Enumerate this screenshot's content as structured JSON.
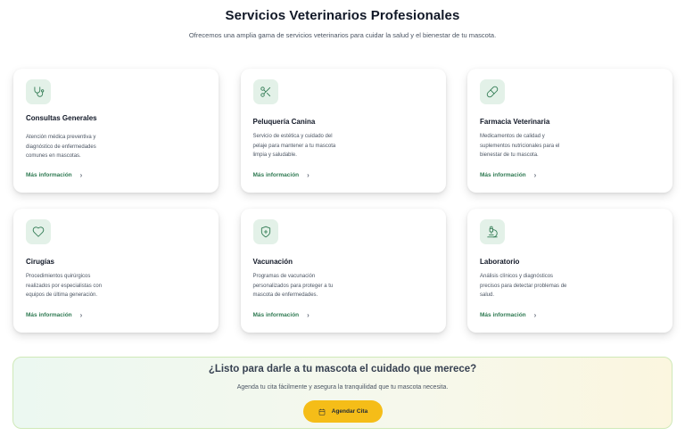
{
  "header": {
    "title": "Servicios Veterinarios Profesionales",
    "subtitle": "Ofrecemos una amplia gama de servicios veterinarios para cuidar la salud y el bienestar de tu mascota."
  },
  "services": [
    {
      "icon": "stethoscope-icon",
      "title": "Consultas Generales",
      "description": "Atención médica preventiva y diagnóstico de enfermedades comunes en mascotas.",
      "link": "Más información"
    },
    {
      "icon": "scissors-icon",
      "title": "Peluquería Canina",
      "description": "Servicio de estética y cuidado del pelaje para mantener a tu mascota limpia y saludable.",
      "link": "Más información"
    },
    {
      "icon": "pill-icon",
      "title": "Farmacia Veterinaria",
      "description": "Medicamentos de calidad y suplementos nutricionales para el bienestar de tu mascota.",
      "link": "Más información"
    },
    {
      "icon": "heart-icon",
      "title": "Cirugías",
      "description": "Procedimientos quirúrgicos realizados por especialistas con equipos de última generación.",
      "link": "Más información"
    },
    {
      "icon": "shield-plus-icon",
      "title": "Vacunación",
      "description": "Programas de vacunación personalizados para proteger a tu mascota de enfermedades.",
      "link": "Más información"
    },
    {
      "icon": "microscope-icon",
      "title": "Laboratorio",
      "description": "Análisis clínicos y diagnósticos precisos para detectar problemas de salud.",
      "link": "Más información"
    }
  ],
  "cta": {
    "title": "¿Listo para darle a tu mascota el cuidado que merece?",
    "text": "Agenda tu cita fácilmente y asegura la tranquilidad que tu mascota necesita.",
    "button_label": "Agendar Cita",
    "button_icon": "calendar-icon"
  },
  "colors": {
    "accent_green": "#2f7a52",
    "icon_bg": "#e3f1e8",
    "button_yellow": "#f5bd18"
  }
}
